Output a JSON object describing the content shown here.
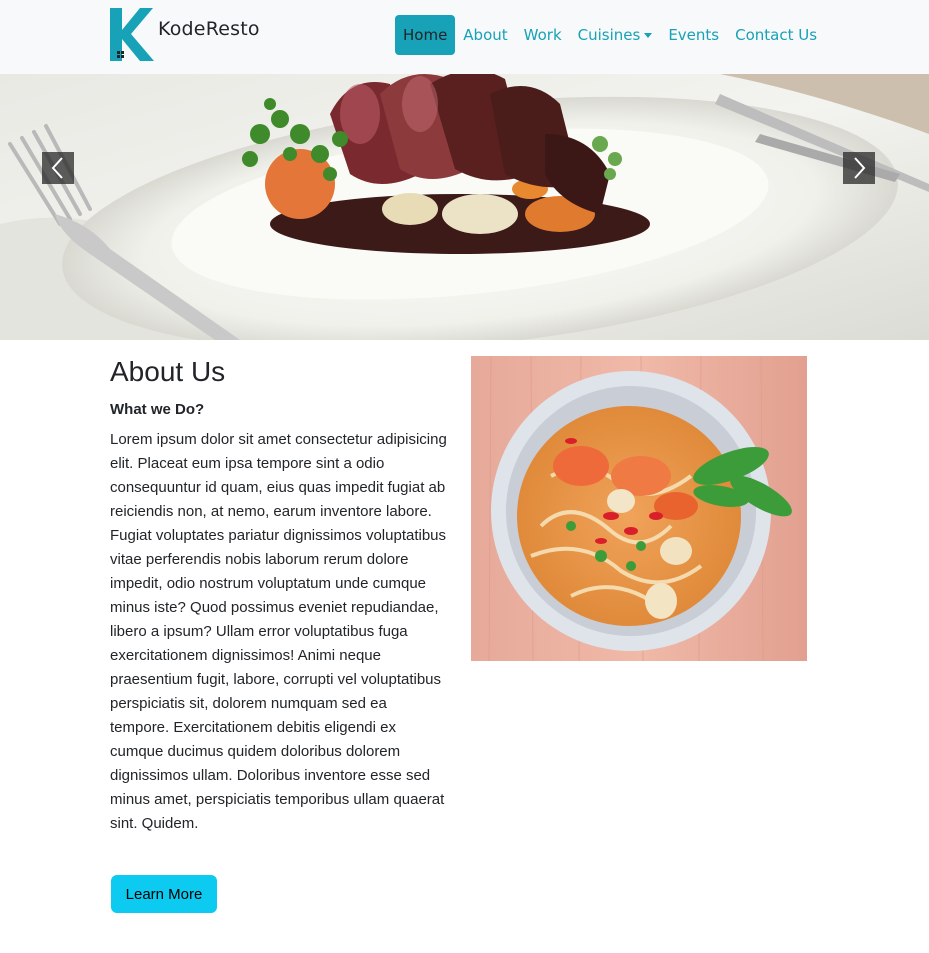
{
  "brand": {
    "name": "KodeResto",
    "logo_icon": "k-logo-icon",
    "accent": "#17a2b8"
  },
  "nav": {
    "items": [
      {
        "label": "Home",
        "active": true
      },
      {
        "label": "About"
      },
      {
        "label": "Work"
      },
      {
        "label": "Cuisines",
        "dropdown": true
      },
      {
        "label": "Events"
      },
      {
        "label": "Contact Us"
      }
    ]
  },
  "carousel": {
    "prev_icon": "chevron-left-icon",
    "next_icon": "chevron-right-icon",
    "slide_image": "steak-dinner-plate-image"
  },
  "about": {
    "title": "About Us",
    "subtitle": "What we Do?",
    "body": "Lorem ipsum dolor sit amet consectetur adipisicing elit. Placeat eum ipsa tempore sint a odio consequuntur id quam, eius quas impedit fugiat ab reiciendis non, at nemo, earum inventore labore. Fugiat voluptates pariatur dignissimos voluptatibus vitae perferendis nobis laborum rerum dolore impedit, odio nostrum voluptatum unde cumque minus iste? Quod possimus eveniet repudiandae, libero a ipsum? Ullam error voluptatibus fuga exercitationem dignissimos! Animi neque praesentium fugit, labore, corrupti vel voluptatibus perspiciatis sit, dolorem numquam sed ea tempore. Exercitationem debitis eligendi ex cumque ducimus quidem doloribus dolorem dignissimos ullam. Doloribus inventore esse sed minus amet, perspiciatis temporibus ullam quaerat sint. Quidem.",
    "button_label": "Learn More",
    "button_color": "#0dcaf0",
    "image": "noodle-soup-bowl-image"
  }
}
